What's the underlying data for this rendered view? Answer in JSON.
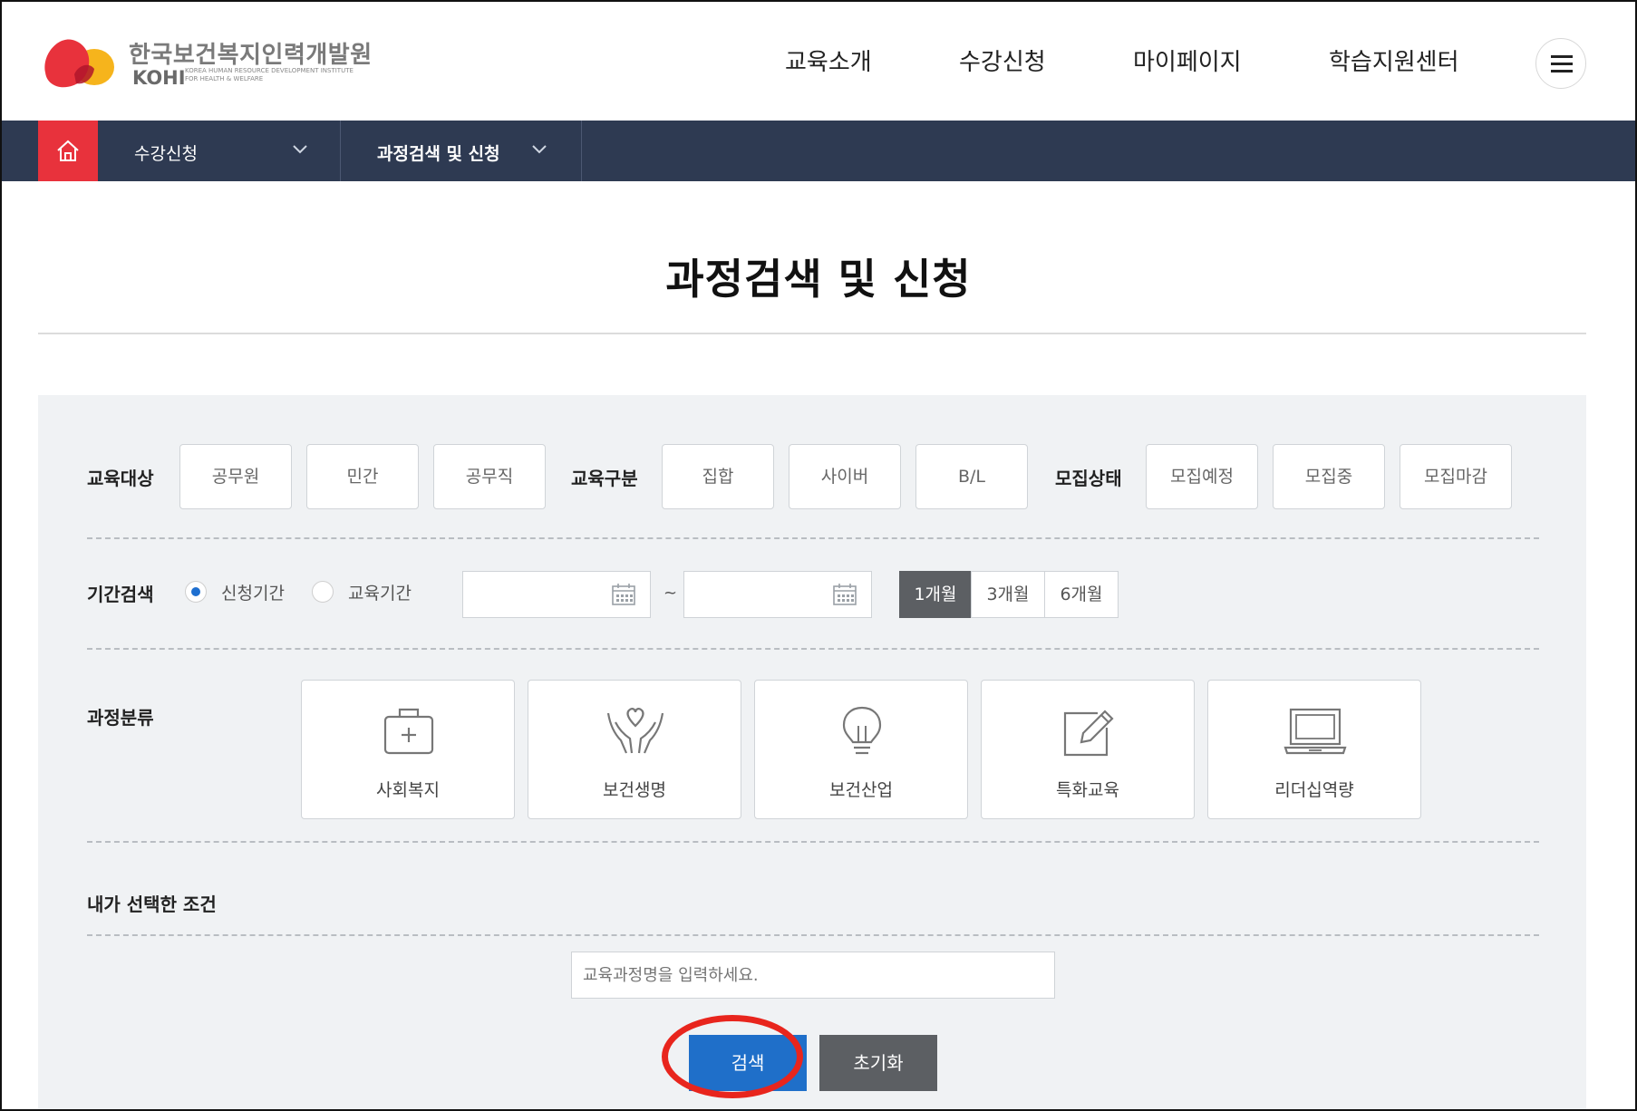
{
  "brand": {
    "name_ko": "한국보건복지인력개발원",
    "name_en": "KOHI",
    "name_en_full": "KOREA HUMAN RESOURCE DEVELOPMENT INSTITUTE FOR HEALTH & WELFARE"
  },
  "gnb": [
    "교육소개",
    "수강신청",
    "마이페이지",
    "학습지원센터"
  ],
  "breadcrumb": {
    "level1": "수강신청",
    "level2": "과정검색 및 신청"
  },
  "page_title": "과정검색 및 신청",
  "filters": {
    "target": {
      "label": "교육대상",
      "options": [
        "공무원",
        "민간",
        "공무직"
      ]
    },
    "type": {
      "label": "교육구분",
      "options": [
        "집합",
        "사이버",
        "B/L"
      ]
    },
    "status": {
      "label": "모집상태",
      "options": [
        "모집예정",
        "모집중",
        "모집마감"
      ]
    }
  },
  "period": {
    "label": "기간검색",
    "radio_apply": "신청기간",
    "radio_edu": "교육기간",
    "selected_radio": "신청기간",
    "start_date": "",
    "end_date": "",
    "tilde": "~",
    "quick": [
      "1개월",
      "3개월",
      "6개월"
    ],
    "active_quick": "1개월"
  },
  "category": {
    "label": "과정분류",
    "items": [
      {
        "label": "사회복지",
        "icon": "medical-kit-icon"
      },
      {
        "label": "보건생명",
        "icon": "heart-hands-icon"
      },
      {
        "label": "보건산업",
        "icon": "lightbulb-icon"
      },
      {
        "label": "특화교육",
        "icon": "pencil-edit-icon"
      },
      {
        "label": "리더십역량",
        "icon": "laptop-icon"
      }
    ]
  },
  "selected": {
    "label": "내가 선택한 조건"
  },
  "keyword": {
    "placeholder": "교육과정명을 입력하세요.",
    "value": ""
  },
  "buttons": {
    "search": "검색",
    "reset": "초기화"
  },
  "colors": {
    "nav_bar": "#2e3a52",
    "home_button": "#e8323c",
    "search_button": "#1f6fc9",
    "active_period": "#5c5f63",
    "annotation_circle": "#e8251d"
  }
}
